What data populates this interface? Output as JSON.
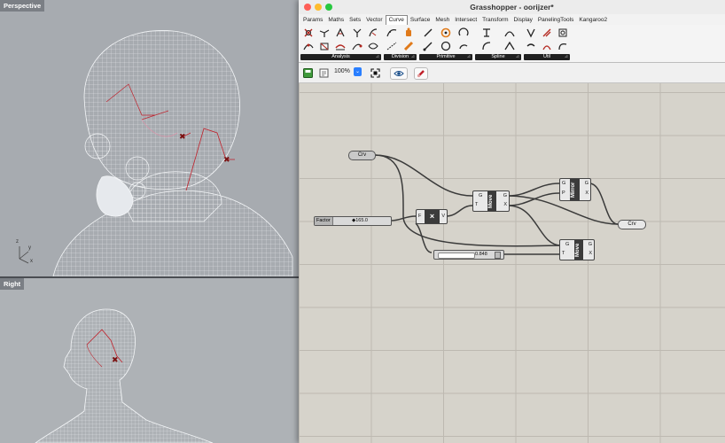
{
  "viewports": {
    "top_title": "Perspective",
    "bottom_title": "Right",
    "axis_labels": {
      "z": "z",
      "y": "y",
      "x": "x"
    }
  },
  "window": {
    "title": "Grasshopper - oorijzer*"
  },
  "menu": [
    "Params",
    "Maths",
    "Sets",
    "Vector",
    "Curve",
    "Surface",
    "Mesh",
    "Intersect",
    "Transform",
    "Display",
    "PanelingTools",
    "Kangaroo2"
  ],
  "menu_active": "Curve",
  "ribbon_groups": [
    "Analysis",
    "Division",
    "Primitive",
    "Spline",
    "Util"
  ],
  "toolbar": {
    "zoom": "100%"
  },
  "canvas": {
    "crv_in_label": "Crv",
    "crv_out_label": "Crv",
    "factor_label": "Factor",
    "factor_value": "◆165.0",
    "slider2_value": "0.848",
    "multiply_core": "×",
    "multiply_in_a": "F",
    "multiply_in_b": "",
    "multiply_out": "V",
    "move1": {
      "core": "Move",
      "in_g": "G",
      "in_t": "T",
      "out_g": "G",
      "out_x": "X"
    },
    "mirror": {
      "core": "Mirror",
      "in_g": "G",
      "in_p": "P",
      "out_g": "G",
      "out_x": "X"
    },
    "move2": {
      "core": "Move",
      "in_g": "G",
      "in_t": "T",
      "out_g": "G",
      "out_x": "X"
    }
  },
  "colors": {
    "canvas_bg": "#d6d3cb",
    "component_core": "#3b3b3b",
    "curve_red": "#c0212b"
  }
}
